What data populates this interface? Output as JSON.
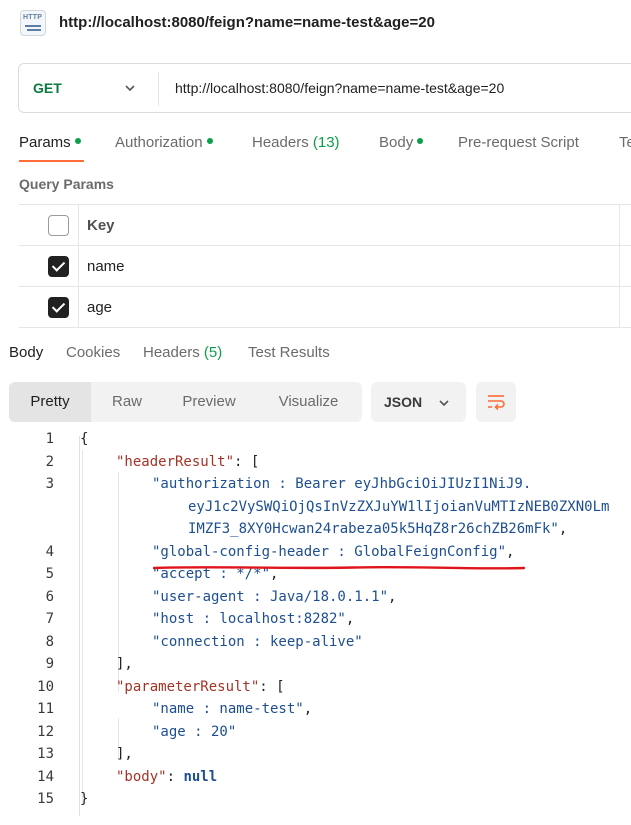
{
  "titlebar": {
    "icon": "http-request-icon",
    "icon_text": "HTTP",
    "title": "http://localhost:8080/feign?name=name-test&age=20"
  },
  "request": {
    "method": "GET",
    "url": "http://localhost:8080/feign?name=name-test&age=20"
  },
  "request_tabs": [
    {
      "label": "Params",
      "dot": true,
      "active": true
    },
    {
      "label": "Authorization",
      "dot": true
    },
    {
      "label": "Headers",
      "count": "(13)"
    },
    {
      "label": "Body",
      "dot": true
    },
    {
      "label": "Pre-request Script"
    },
    {
      "label": "Te"
    }
  ],
  "query_params": {
    "title": "Query Params",
    "header_key": "Key",
    "rows": [
      {
        "key": "name",
        "checked": true
      },
      {
        "key": "age",
        "checked": true
      }
    ]
  },
  "response_tabs": [
    {
      "label": "Body",
      "active": true
    },
    {
      "label": "Cookies"
    },
    {
      "label": "Headers",
      "count": "(5)"
    },
    {
      "label": "Test Results"
    }
  ],
  "view_modes": [
    "Pretty",
    "Raw",
    "Preview",
    "Visualize"
  ],
  "active_view": "Pretty",
  "format": "JSON",
  "colors": {
    "accent": "#ff6c37",
    "method_green": "#0b7a3e",
    "status_green": "#0c9f4a",
    "json_key": "#a33426",
    "json_string": "#1d4f91",
    "annotation_red": "#e0141c"
  },
  "code": {
    "line_numbers": [
      "1",
      "2",
      "3",
      "4",
      "5",
      "6",
      "7",
      "8",
      "9",
      "10",
      "11",
      "12",
      "13",
      "14",
      "15"
    ],
    "l1": "{",
    "l2_key": "\"headerResult\"",
    "l2_rest": ": [",
    "l3a": "\"authorization : Bearer eyJhbGciOiJIUzI1NiJ9.",
    "l3b": "eyJ1c2VySWQiOjQsInVzZXJuYW1lIjoianVuMTIzNEB0ZXN0Lm",
    "l3c": "IMZF3_8XY0Hcwan24rabeza05k5HqZ8r26chZB26mFk\"",
    "l3_comma": ",",
    "l4": "\"global-config-header : GlobalFeignConfig\"",
    "l4_comma": ",",
    "l5": "\"accept : */*\"",
    "l5_comma": ",",
    "l6": "\"user-agent : Java/18.0.1.1\"",
    "l6_comma": ",",
    "l7": "\"host : localhost:8282\"",
    "l7_comma": ",",
    "l8": "\"connection : keep-alive\"",
    "l9": "],",
    "l10_key": "\"parameterResult\"",
    "l10_rest": ": [",
    "l11": "\"name : name-test\"",
    "l11_comma": ",",
    "l12": "\"age : 20\"",
    "l13": "],",
    "l14_key": "\"body\"",
    "l14_sep": ": ",
    "l14_val": "null",
    "l15": "}"
  }
}
